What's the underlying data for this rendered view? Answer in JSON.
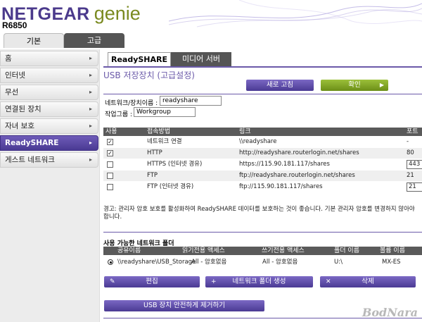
{
  "header": {
    "brand": "NETGEAR",
    "genie": "genie",
    "model": "R6850"
  },
  "top_tabs": {
    "basic": "기본",
    "advanced": "고급"
  },
  "sidebar": {
    "items": [
      {
        "label": "홈"
      },
      {
        "label": "인터넷"
      },
      {
        "label": "무선"
      },
      {
        "label": "연결된 장치"
      },
      {
        "label": "자녀 보호"
      },
      {
        "label": "ReadySHARE",
        "active": true
      },
      {
        "label": "게스트 네트워크"
      }
    ],
    "arrow": "▸"
  },
  "tabs": {
    "readyshare": "ReadySHARE",
    "media_server": "미디어 서버"
  },
  "page_title": "USB 저장장치 (고급설정)",
  "buttons": {
    "refresh": "새로 고침",
    "apply": "확인",
    "edit": "편집",
    "create_folder": "네트워크 폴더 생성",
    "delete": "삭제",
    "safe_remove": "USB 장치 안전하게 제거하기"
  },
  "form": {
    "device_name_label": "네트워크/장치이름 :",
    "device_name_value": "readyshare",
    "workgroup_label": "작업그룹 :",
    "workgroup_value": "Workgroup"
  },
  "access_table": {
    "headers": {
      "use": "사용",
      "method": "접속방법",
      "link": "링크",
      "port": "포트"
    },
    "rows": [
      {
        "checked": true,
        "method": "네트워크 연결",
        "link": "\\\\readyshare",
        "port": "-"
      },
      {
        "checked": true,
        "method": "HTTP",
        "link": "http://readyshare.routerlogin.net/shares",
        "port": "80"
      },
      {
        "checked": false,
        "method": "HTTPS (인터넷 경유)",
        "link": "https://115.90.181.117/shares",
        "port": "443"
      },
      {
        "checked": false,
        "method": "FTP",
        "link": "ftp://readyshare.routerlogin.net/shares",
        "port": "21"
      },
      {
        "checked": false,
        "method": "FTP (인터넷 경유)",
        "link": "ftp://115.90.181.117/shares",
        "port": "21"
      }
    ]
  },
  "warning": "경고: 관리자 암호 보호를 활성화하여 ReadySHARE 데이터를 보호하는 것이 좋습니다. 기본 관리자 암호를 변경하지 않아야 합니다.",
  "folders": {
    "title": "사용 가능한 네트워크 폴더",
    "headers": {
      "share_name": "공유이름",
      "read_access": "읽기전용 액세스",
      "write_access": "쓰기전용 액세스",
      "folder_name": "폴더 이름",
      "volume_name": "볼륨 이름"
    },
    "rows": [
      {
        "share_name": "\\\\readyshare\\USB_Storage",
        "read_access": "All - 암호없음",
        "write_access": "All - 암호없음",
        "folder_name": "U:\\",
        "volume_name": "MX-ES"
      }
    ]
  },
  "watermark": "BodNara",
  "colors": {
    "accent": "#6b5aa9",
    "active": "#4a3a93",
    "apply": "#7a9b22",
    "table_header": "#5a5a5a"
  }
}
